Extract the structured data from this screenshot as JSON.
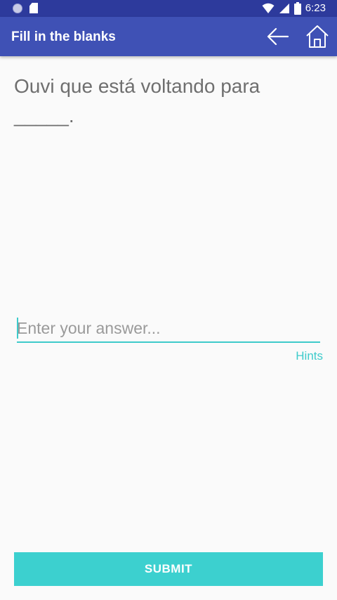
{
  "status_bar": {
    "time": "6:23",
    "icons": [
      "notification-dot-icon",
      "sd-card-icon",
      "wifi-icon",
      "signal-icon",
      "battery-icon"
    ]
  },
  "app_bar": {
    "title": "Fill in the blanks",
    "icons": [
      "back-arrow-icon",
      "home-icon"
    ]
  },
  "question": {
    "text": "Ouvi que está voltando para _____."
  },
  "answer": {
    "placeholder": "Enter your answer...",
    "value": ""
  },
  "hints_label": "Hints",
  "submit_label": "SUBMIT",
  "colors": {
    "status_bar": "#2d3a9c",
    "app_bar": "#3f51b5",
    "accent": "#3ecbcb",
    "submit_bg": "#3cd0cf",
    "question_text": "#6f6f6f",
    "background": "#fafafa"
  }
}
